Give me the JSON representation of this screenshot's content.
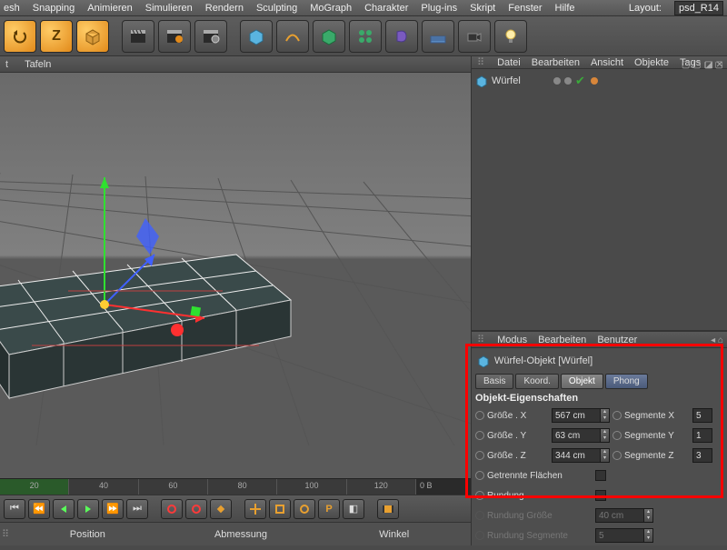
{
  "menubar": {
    "items": [
      "esh",
      "Snapping",
      "Animieren",
      "Simulieren",
      "Rendern",
      "Sculpting",
      "MoGraph",
      "Charakter",
      "Plug-ins",
      "Skript",
      "Fenster",
      "Hilfe"
    ],
    "layout_label": "Layout:",
    "layout_value": "psd_R14"
  },
  "viewport_header": {
    "tf": "Tafeln"
  },
  "ruler": {
    "ticks": [
      "20",
      "40",
      "60",
      "80",
      "100",
      "120"
    ],
    "right": "0 B"
  },
  "coord_panel": {
    "headers": [
      "Position",
      "Abmessung",
      "Winkel"
    ]
  },
  "panel_top": {
    "items": [
      "Datei",
      "Bearbeiten",
      "Ansicht",
      "Objekte",
      "Tags"
    ]
  },
  "tree": {
    "item0": "Würfel"
  },
  "attr_menu": {
    "items": [
      "Modus",
      "Bearbeiten",
      "Benutzer"
    ]
  },
  "attr": {
    "title": "Würfel-Objekt [Würfel]",
    "tabs": [
      "Basis",
      "Koord.",
      "Objekt",
      "Phong"
    ],
    "section": "Objekt-Eigenschaften",
    "rows": {
      "sx": {
        "label": "Größe . X",
        "value": "567 cm",
        "seglabel": "Segmente X",
        "segvalue": "5"
      },
      "sy": {
        "label": "Größe . Y",
        "value": "63 cm",
        "seglabel": "Segmente Y",
        "segvalue": "1"
      },
      "sz": {
        "label": "Größe . Z",
        "value": "344 cm",
        "seglabel": "Segmente Z",
        "segvalue": "3"
      },
      "sep": {
        "label": "Getrennte Flächen"
      },
      "rnd": {
        "label": "Rundung"
      },
      "rsz": {
        "label": "Rundung Größe",
        "value": "40 cm"
      },
      "rsg": {
        "label": "Rundung Segmente",
        "value": "5"
      }
    }
  }
}
